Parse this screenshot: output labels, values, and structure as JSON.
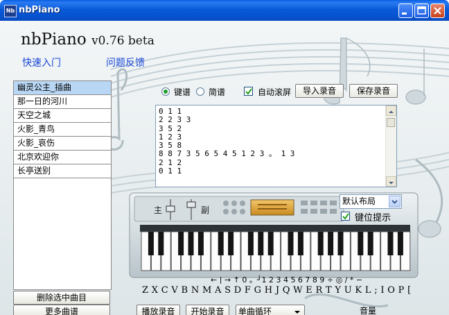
{
  "window": {
    "title": "nbPiano",
    "icon_text": "Nb",
    "controls": [
      "minimize-icon",
      "maximize-icon",
      "close-icon"
    ]
  },
  "header": {
    "app_name": "nbPiano",
    "version": "v0.76 beta",
    "links": {
      "quick_start": "快速入门",
      "feedback": "问题反馈"
    }
  },
  "songs": {
    "items": [
      "幽灵公主_插曲",
      "那一日的河川",
      "天空之城",
      "火影_青鸟",
      "火影_哀伤",
      "北京欢迎你",
      "长亭送别"
    ],
    "selected_index": 0,
    "delete_label": "删除选中曲目",
    "more_label": "更多曲谱"
  },
  "notation_mode": {
    "keyboard_label": "键谱",
    "numbered_label": "简谱",
    "selected": "键谱",
    "autoscroll_label": "自动滚屏",
    "autoscroll_checked": true
  },
  "recording": {
    "import_label": "导入录音",
    "save_label": "保存录音",
    "play_label": "播放录音",
    "start_label": "开始录音",
    "loop_mode": "单曲循环"
  },
  "notation_text": "0 1 1\n2 2 3 3\n3 5 2\n1 2 3\n3 5 8\n8 8 7 3 5 6 5 4 5 1 2 3 。 1 3\n2 1 2\n0 1 1",
  "keyboard": {
    "layout_select": "默认布局",
    "hint_label": "键位提示",
    "hint_checked": true,
    "main_label": "主",
    "sub_label": "副",
    "top_keymap": "← | → ↑ 0 。┘1 2 3 4 5 6 7 8 9 ÷ ◎ / * −",
    "bottom_keymap": "Z X C V B N M A  S D F  G H J Q W E R T Y U K L ;  I O  P ["
  },
  "volume_label": "音量",
  "colors": {
    "title_bar": "#0a5ad8",
    "link": "#1a47d6",
    "selected_song": "#b9d7f5",
    "radio_dot": "#1c9c2b"
  }
}
